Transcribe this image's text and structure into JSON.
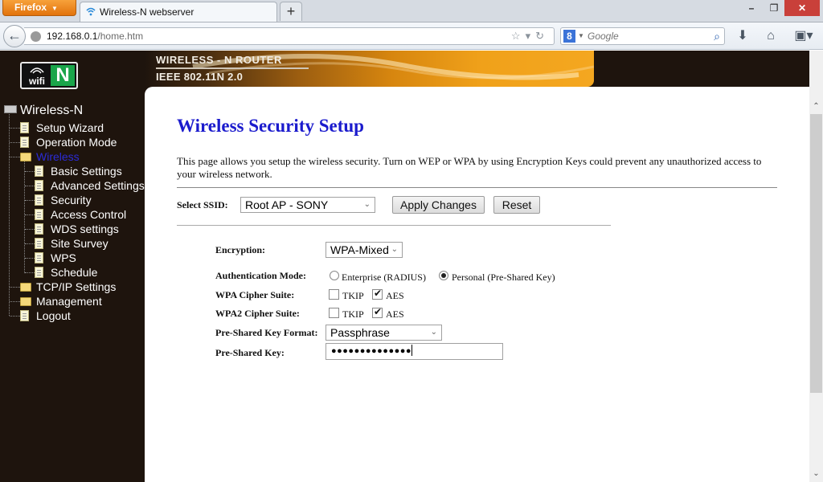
{
  "browser": {
    "app_button": "Firefox",
    "tab_title": "Wireless-N webserver",
    "new_tab": "+",
    "url_host": "192.168.0.1",
    "url_path": "/home.htm",
    "search_placeholder": "Google",
    "window_controls": {
      "minimize": "–",
      "maximize": "❐",
      "close": "✕"
    }
  },
  "banner": {
    "title": "WIRELESS - N ROUTER",
    "subtitle": "IEEE 802.11N 2.0",
    "logo_wifi": "wifi",
    "logo_n": "N"
  },
  "sidebar": {
    "root": "Wireless-N",
    "items": [
      {
        "label": "Setup Wizard",
        "type": "doc",
        "level": 1
      },
      {
        "label": "Operation Mode",
        "type": "doc",
        "level": 1
      },
      {
        "label": "Wireless",
        "type": "folder-open",
        "level": 1,
        "active": true
      },
      {
        "label": "Basic Settings",
        "type": "doc",
        "level": 2
      },
      {
        "label": "Advanced Settings",
        "type": "doc",
        "level": 2
      },
      {
        "label": "Security",
        "type": "doc",
        "level": 2
      },
      {
        "label": "Access Control",
        "type": "doc",
        "level": 2
      },
      {
        "label": "WDS settings",
        "type": "doc",
        "level": 2
      },
      {
        "label": "Site Survey",
        "type": "doc",
        "level": 2
      },
      {
        "label": "WPS",
        "type": "doc",
        "level": 2
      },
      {
        "label": "Schedule",
        "type": "doc",
        "level": 2
      },
      {
        "label": "TCP/IP Settings",
        "type": "folder",
        "level": 1
      },
      {
        "label": "Management",
        "type": "folder",
        "level": 1
      },
      {
        "label": "Logout",
        "type": "doc",
        "level": 1
      }
    ]
  },
  "main": {
    "title": "Wireless Security Setup",
    "description": "This page allows you setup the wireless security. Turn on WEP or WPA by using Encryption Keys could prevent any unauthorized access to your wireless network.",
    "ssid_label": "Select SSID:",
    "ssid_value": "Root AP - SONY",
    "apply_button": "Apply Changes",
    "reset_button": "Reset",
    "encryption_label": "Encryption:",
    "encryption_value": "WPA-Mixed",
    "auth_label": "Authentication Mode:",
    "auth_options": [
      {
        "label": "Enterprise (RADIUS)",
        "selected": false
      },
      {
        "label": "Personal (Pre-Shared Key)",
        "selected": true
      }
    ],
    "wpa_cipher_label": "WPA Cipher Suite:",
    "wpa_cipher": [
      {
        "label": "TKIP",
        "checked": false
      },
      {
        "label": "AES",
        "checked": true
      }
    ],
    "wpa2_cipher_label": "WPA2 Cipher Suite:",
    "wpa2_cipher": [
      {
        "label": "TKIP",
        "checked": false
      },
      {
        "label": "AES",
        "checked": true
      }
    ],
    "psk_format_label": "Pre-Shared Key Format:",
    "psk_format_value": "Passphrase",
    "psk_label": "Pre-Shared Key:",
    "psk_masked": "●●●●●●●●●●●●●●"
  }
}
